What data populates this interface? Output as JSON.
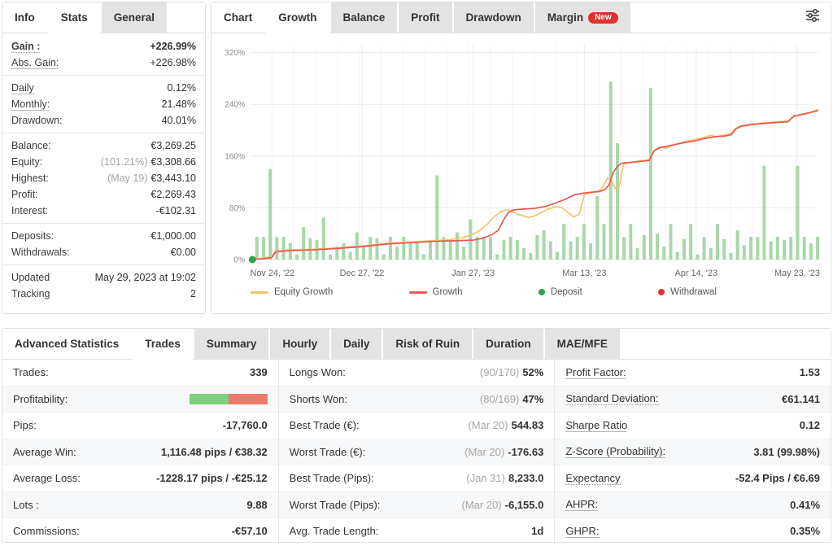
{
  "left_panel": {
    "tabs": [
      {
        "label": "Info"
      },
      {
        "label": "Stats"
      },
      {
        "label": "General"
      }
    ],
    "rows": [
      {
        "label": "Gain :",
        "value": "+226.99%"
      },
      {
        "label": "Abs. Gain:",
        "value": "+226.98%"
      },
      {
        "label": "Daily",
        "value": "0.12%"
      },
      {
        "label": "Monthly:",
        "value": "21.48%"
      },
      {
        "label": "Drawdown:",
        "value": "40.01%"
      },
      {
        "label": "Balance:",
        "value": "€3,269.25"
      },
      {
        "label": "Equity:",
        "prefix": "(101.21%)",
        "value": "€3,308.66"
      },
      {
        "label": "Highest:",
        "prefix": "(May 19)",
        "value": "€3,443.10"
      },
      {
        "label": "Profit:",
        "value": "€2,269.43"
      },
      {
        "label": "Interest:",
        "value": "-€102.31"
      },
      {
        "label": "Deposits:",
        "value": "€1,000.00"
      },
      {
        "label": "Withdrawals:",
        "value": "€0.00"
      },
      {
        "label": "Updated",
        "value": "May 29, 2023 at 19:02"
      },
      {
        "label": "Tracking",
        "value": "2"
      }
    ]
  },
  "chart_panel": {
    "tabs": [
      {
        "label": "Chart"
      },
      {
        "label": "Growth"
      },
      {
        "label": "Balance"
      },
      {
        "label": "Profit"
      },
      {
        "label": "Drawdown"
      },
      {
        "label": "Margin"
      }
    ],
    "new_badge": "New",
    "legend": [
      {
        "label": "Equity Growth",
        "color": "#f6c36e",
        "shape": "line"
      },
      {
        "label": "Growth",
        "color": "#e8594f",
        "shape": "line"
      },
      {
        "label": "Deposit",
        "color": "#2da44e",
        "shape": "dot"
      },
      {
        "label": "Withdrawal",
        "color": "#e03131",
        "shape": "dot"
      }
    ]
  },
  "chart_data": {
    "type": "composite",
    "y_unit": "%",
    "ylim": [
      0,
      332
    ],
    "y_ticks": [
      0,
      80,
      160,
      240,
      320
    ],
    "y_tick_labels": [
      "0%",
      "80%",
      "160%",
      "240%",
      "320%"
    ],
    "x_ticks": [
      {
        "label": "Nov 24, '22",
        "f": 0.0
      },
      {
        "label": "Dec 27, '22",
        "f": 0.197
      },
      {
        "label": "Jan 27, '23",
        "f": 0.393
      },
      {
        "label": "Mar 13, '23",
        "f": 0.589
      },
      {
        "label": "Apr 14, '23",
        "f": 0.786
      },
      {
        "label": "May 23, '23",
        "f": 0.964
      }
    ],
    "bars": {
      "name": "daily-gain-bars",
      "color": "#a9d7a9",
      "values": [
        0,
        35,
        35,
        140,
        35,
        35,
        25,
        8,
        50,
        33,
        30,
        65,
        8,
        20,
        25,
        12,
        42,
        22,
        35,
        33,
        8,
        35,
        20,
        35,
        28,
        28,
        8,
        30,
        130,
        35,
        30,
        42,
        20,
        62,
        35,
        35,
        35,
        8,
        30,
        35,
        30,
        18,
        10,
        38,
        45,
        28,
        12,
        55,
        28,
        35,
        55,
        25,
        98,
        55,
        275,
        180,
        35,
        55,
        18,
        38,
        265,
        40,
        20,
        55,
        12,
        32,
        55,
        8,
        35,
        18,
        55,
        32,
        10,
        45,
        22,
        35,
        35,
        145,
        28,
        35,
        30,
        35,
        145,
        35,
        25,
        35
      ]
    },
    "lines": [
      {
        "name": "Equity Growth",
        "color": "#f6c36e",
        "points": [
          [
            0,
            0
          ],
          [
            0.02,
            2
          ],
          [
            0.038,
            5
          ],
          [
            0.045,
            13
          ],
          [
            0.07,
            15
          ],
          [
            0.11,
            16
          ],
          [
            0.15,
            18
          ],
          [
            0.197,
            21
          ],
          [
            0.24,
            25
          ],
          [
            0.28,
            27
          ],
          [
            0.32,
            29
          ],
          [
            0.355,
            31
          ],
          [
            0.375,
            34
          ],
          [
            0.39,
            38
          ],
          [
            0.405,
            45
          ],
          [
            0.418,
            55
          ],
          [
            0.43,
            66
          ],
          [
            0.44,
            73
          ],
          [
            0.45,
            77
          ],
          [
            0.46,
            75
          ],
          [
            0.47,
            71
          ],
          [
            0.48,
            68
          ],
          [
            0.49,
            65
          ],
          [
            0.5,
            67
          ],
          [
            0.512,
            72
          ],
          [
            0.525,
            78
          ],
          [
            0.54,
            82
          ],
          [
            0.55,
            80
          ],
          [
            0.56,
            73
          ],
          [
            0.57,
            66
          ],
          [
            0.58,
            70
          ],
          [
            0.589,
            100
          ],
          [
            0.6,
            103
          ],
          [
            0.61,
            105
          ],
          [
            0.618,
            108
          ],
          [
            0.625,
            118
          ],
          [
            0.63,
            126
          ],
          [
            0.637,
            122
          ],
          [
            0.643,
            110
          ],
          [
            0.65,
            112
          ],
          [
            0.658,
            147
          ],
          [
            0.668,
            150
          ],
          [
            0.69,
            153
          ],
          [
            0.703,
            154
          ],
          [
            0.712,
            169
          ],
          [
            0.722,
            174
          ],
          [
            0.733,
            172
          ],
          [
            0.745,
            177
          ],
          [
            0.76,
            181
          ],
          [
            0.787,
            186
          ],
          [
            0.8,
            189
          ],
          [
            0.812,
            192
          ],
          [
            0.822,
            190
          ],
          [
            0.838,
            193
          ],
          [
            0.848,
            196
          ],
          [
            0.856,
            203
          ],
          [
            0.865,
            207
          ],
          [
            0.88,
            209
          ],
          [
            0.9,
            211
          ],
          [
            0.93,
            213
          ],
          [
            0.948,
            214
          ],
          [
            0.958,
            221
          ],
          [
            0.972,
            225
          ],
          [
            0.985,
            226
          ],
          [
            1,
            232
          ]
        ]
      },
      {
        "name": "Growth",
        "color": "#e8594f",
        "points": [
          [
            0,
            0
          ],
          [
            0.02,
            1
          ],
          [
            0.038,
            3
          ],
          [
            0.045,
            12
          ],
          [
            0.07,
            14
          ],
          [
            0.11,
            15
          ],
          [
            0.15,
            17
          ],
          [
            0.197,
            20
          ],
          [
            0.24,
            24
          ],
          [
            0.28,
            26
          ],
          [
            0.32,
            28
          ],
          [
            0.36,
            29
          ],
          [
            0.393,
            30
          ],
          [
            0.41,
            33
          ],
          [
            0.425,
            38
          ],
          [
            0.437,
            45
          ],
          [
            0.447,
            62
          ],
          [
            0.455,
            73
          ],
          [
            0.465,
            77
          ],
          [
            0.48,
            78
          ],
          [
            0.5,
            79
          ],
          [
            0.52,
            82
          ],
          [
            0.54,
            88
          ],
          [
            0.557,
            94
          ],
          [
            0.571,
            100
          ],
          [
            0.589,
            103
          ],
          [
            0.6,
            104
          ],
          [
            0.615,
            105
          ],
          [
            0.625,
            108
          ],
          [
            0.632,
            115
          ],
          [
            0.64,
            135
          ],
          [
            0.648,
            145
          ],
          [
            0.655,
            149
          ],
          [
            0.67,
            150
          ],
          [
            0.69,
            152
          ],
          [
            0.703,
            153
          ],
          [
            0.712,
            168
          ],
          [
            0.722,
            173
          ],
          [
            0.74,
            176
          ],
          [
            0.76,
            180
          ],
          [
            0.787,
            184
          ],
          [
            0.8,
            187
          ],
          [
            0.82,
            190
          ],
          [
            0.838,
            191
          ],
          [
            0.848,
            193
          ],
          [
            0.856,
            202
          ],
          [
            0.865,
            206
          ],
          [
            0.88,
            208
          ],
          [
            0.9,
            210
          ],
          [
            0.93,
            212
          ],
          [
            0.948,
            213
          ],
          [
            0.958,
            222
          ],
          [
            0.972,
            224
          ],
          [
            0.985,
            227
          ],
          [
            1,
            230
          ]
        ]
      }
    ],
    "markers": [
      {
        "name": "Deposit",
        "color": "#2da44e",
        "f": 0.004,
        "value": 0
      }
    ]
  },
  "stats_panel": {
    "title": "Advanced Statistics",
    "tabs": [
      {
        "label": "Trades"
      },
      {
        "label": "Summary"
      },
      {
        "label": "Hourly"
      },
      {
        "label": "Daily"
      },
      {
        "label": "Risk of Ruin"
      },
      {
        "label": "Duration"
      },
      {
        "label": "MAE/MFE"
      }
    ],
    "profitability": {
      "win_pct": 50,
      "loss_pct": 50,
      "win_color": "#7ed07e",
      "loss_color": "#ee7a6c"
    },
    "columns": [
      {
        "rows": [
          {
            "label": "Trades:",
            "value": "339"
          },
          {
            "label": "Profitability:",
            "value": ""
          },
          {
            "label": "Pips:",
            "value": "-17,760.0"
          },
          {
            "label": "Average Win:",
            "value": "1,116.48 pips / €38.32"
          },
          {
            "label": "Average Loss:",
            "value": "-1228.17 pips / -€25.12"
          },
          {
            "label": "Lots :",
            "value": "9.88"
          },
          {
            "label": "Commissions:",
            "value": "-€57.10"
          }
        ]
      },
      {
        "rows": [
          {
            "label": "Longs Won:",
            "prefix": "(90/170)",
            "value": "52%"
          },
          {
            "label": "Shorts Won:",
            "prefix": "(80/169)",
            "value": "47%"
          },
          {
            "label": "Best Trade (€):",
            "prefix": "(Mar 20)",
            "value": "544.83"
          },
          {
            "label": "Worst Trade (€):",
            "prefix": "(Mar 20)",
            "value": "-176.63"
          },
          {
            "label": "Best Trade (Pips):",
            "prefix": "(Jan 31)",
            "value": "8,233.0"
          },
          {
            "label": "Worst Trade (Pips):",
            "prefix": "(Mar 20)",
            "value": "-6,155.0"
          },
          {
            "label": "Avg. Trade Length:",
            "value": "1d"
          }
        ]
      },
      {
        "rows": [
          {
            "label": "Profit Factor:",
            "value": "1.53"
          },
          {
            "label": "Standard Deviation:",
            "value": "€61.141"
          },
          {
            "label": "Sharpe Ratio",
            "value": "0.12"
          },
          {
            "label": "Z-Score (Probability):",
            "value": "3.81 (99.98%)"
          },
          {
            "label": "Expectancy",
            "value": "-52.4 Pips / €6.69"
          },
          {
            "label": "AHPR:",
            "value": "0.41%"
          },
          {
            "label": "GHPR:",
            "value": "0.35%"
          }
        ]
      }
    ]
  }
}
